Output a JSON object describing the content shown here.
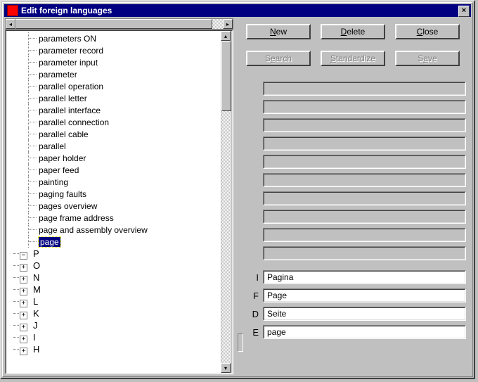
{
  "window": {
    "title": "Edit foreign languages"
  },
  "buttons": {
    "row1": {
      "b1": "New",
      "b2": "Delete",
      "b3": "Close"
    },
    "row2": {
      "b1": "Search",
      "b2": "Standardize",
      "b3": "Save"
    },
    "mn": {
      "b11": "N",
      "b12": "D",
      "b13": "C",
      "b21": "e",
      "b22": "S",
      "b23": "a"
    }
  },
  "tree": {
    "child_items": [
      "parameters  ON",
      "parameter record",
      "parameter input",
      "parameter",
      "parallel operation",
      "parallel letter",
      "parallel interface",
      "parallel connection",
      "parallel cable",
      "parallel",
      "paper holder",
      "paper feed",
      "painting",
      "paging faults",
      "pages overview",
      "page frame address",
      "page and assembly overview",
      "page"
    ],
    "letters": [
      {
        "sym": "−",
        "label": "P"
      },
      {
        "sym": "+",
        "label": "O"
      },
      {
        "sym": "+",
        "label": "N"
      },
      {
        "sym": "+",
        "label": "M"
      },
      {
        "sym": "+",
        "label": "L"
      },
      {
        "sym": "+",
        "label": "K"
      },
      {
        "sym": "+",
        "label": "J"
      },
      {
        "sym": "+",
        "label": "I"
      },
      {
        "sym": "+",
        "label": "H"
      }
    ]
  },
  "fields": {
    "labeled": [
      {
        "label": "I",
        "value": "Pagina",
        "white": true
      },
      {
        "label": "F",
        "value": "Page",
        "white": true
      },
      {
        "label": "D",
        "value": "Seite",
        "white": true
      },
      {
        "label": "E",
        "value": "page",
        "white": true
      }
    ]
  }
}
